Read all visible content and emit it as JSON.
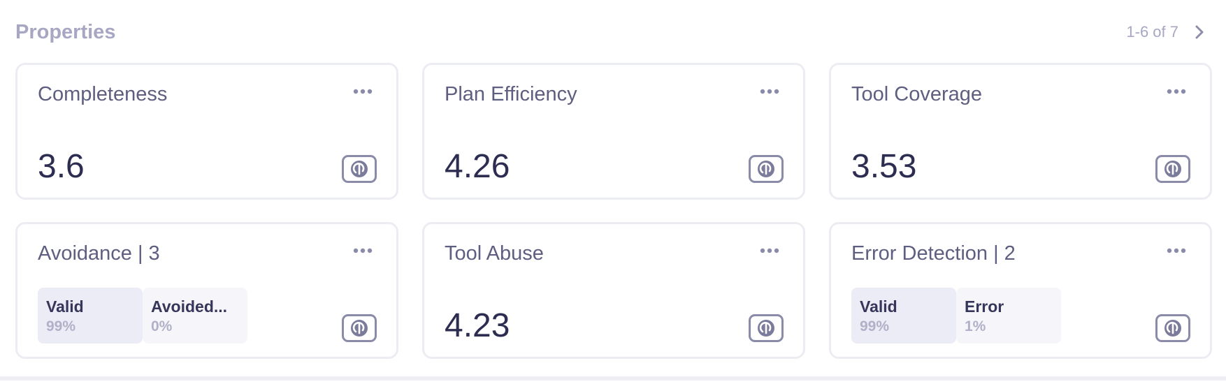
{
  "header": {
    "title": "Properties",
    "pager_text": "1-6 of 7"
  },
  "cards": [
    {
      "title": "Completeness",
      "value": "3.6"
    },
    {
      "title": "Plan Efficiency",
      "value": "4.26"
    },
    {
      "title": "Tool Coverage",
      "value": "3.53"
    },
    {
      "title": "Avoidance | 3",
      "categories": [
        {
          "label": "Valid",
          "pct": "99%"
        },
        {
          "label": "Avoided...",
          "pct": "0%"
        }
      ]
    },
    {
      "title": "Tool Abuse",
      "value": "4.23"
    },
    {
      "title": "Error Detection | 2",
      "categories": [
        {
          "label": "Valid",
          "pct": "99%"
        },
        {
          "label": "Error",
          "pct": "1%"
        }
      ]
    }
  ],
  "icons": {
    "pager_next": "chevron-right-icon",
    "menu": "more-horizontal-icon",
    "badge": "refresh-badge-icon"
  },
  "colors": {
    "title": "#a7a7c4",
    "border": "#ececf3",
    "value": "#2d2d52",
    "badge_border": "#8a8aa9",
    "category_primary_bg": "#ececf6",
    "category_secondary_bg": "#f6f6fa"
  }
}
